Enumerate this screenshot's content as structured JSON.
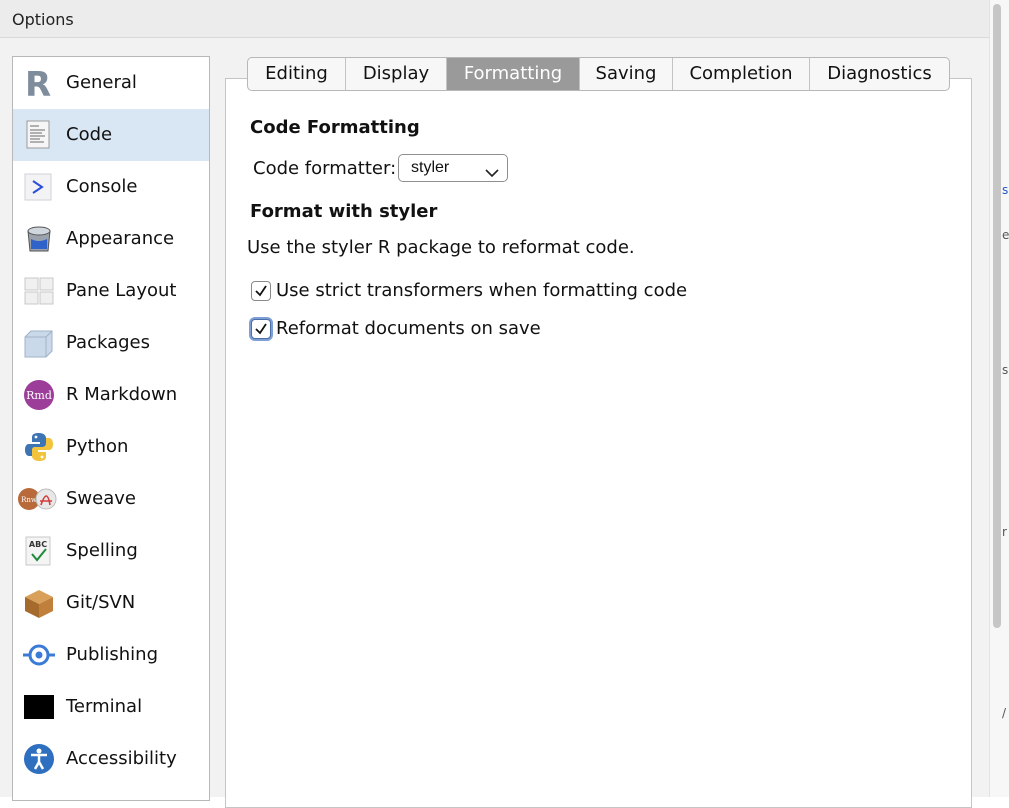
{
  "window": {
    "title": "Options"
  },
  "sidebar": {
    "items": [
      {
        "label": "General",
        "icon": "r-logo-icon"
      },
      {
        "label": "Code",
        "icon": "code-document-icon",
        "selected": true
      },
      {
        "label": "Console",
        "icon": "console-prompt-icon"
      },
      {
        "label": "Appearance",
        "icon": "paint-bucket-icon"
      },
      {
        "label": "Pane Layout",
        "icon": "pane-grid-icon"
      },
      {
        "label": "Packages",
        "icon": "package-box-icon"
      },
      {
        "label": "R Markdown",
        "icon": "rmd-icon"
      },
      {
        "label": "Python",
        "icon": "python-icon"
      },
      {
        "label": "Sweave",
        "icon": "sweave-icon"
      },
      {
        "label": "Spelling",
        "icon": "spellcheck-icon"
      },
      {
        "label": "Git/SVN",
        "icon": "git-box-icon"
      },
      {
        "label": "Publishing",
        "icon": "publish-icon"
      },
      {
        "label": "Terminal",
        "icon": "terminal-icon"
      },
      {
        "label": "Accessibility",
        "icon": "accessibility-icon"
      }
    ]
  },
  "tabs": [
    {
      "label": "Editing"
    },
    {
      "label": "Display"
    },
    {
      "label": "Formatting",
      "active": true
    },
    {
      "label": "Saving"
    },
    {
      "label": "Completion"
    },
    {
      "label": "Diagnostics"
    }
  ],
  "formatting": {
    "section_title": "Code Formatting",
    "formatter_label": "Code formatter:",
    "formatter_value": "styler",
    "styler_heading": "Format with styler",
    "styler_description": "Use the styler R package to reformat code.",
    "checkboxes": [
      {
        "label": "Use strict transformers when formatting code",
        "checked": true
      },
      {
        "label": "Reformat documents on save",
        "checked": true,
        "focused": true
      }
    ]
  },
  "colors": {
    "selected_bg": "#d9e6f4",
    "active_tab": "#9a9a9a",
    "focus_ring": "#7d9fd6"
  }
}
